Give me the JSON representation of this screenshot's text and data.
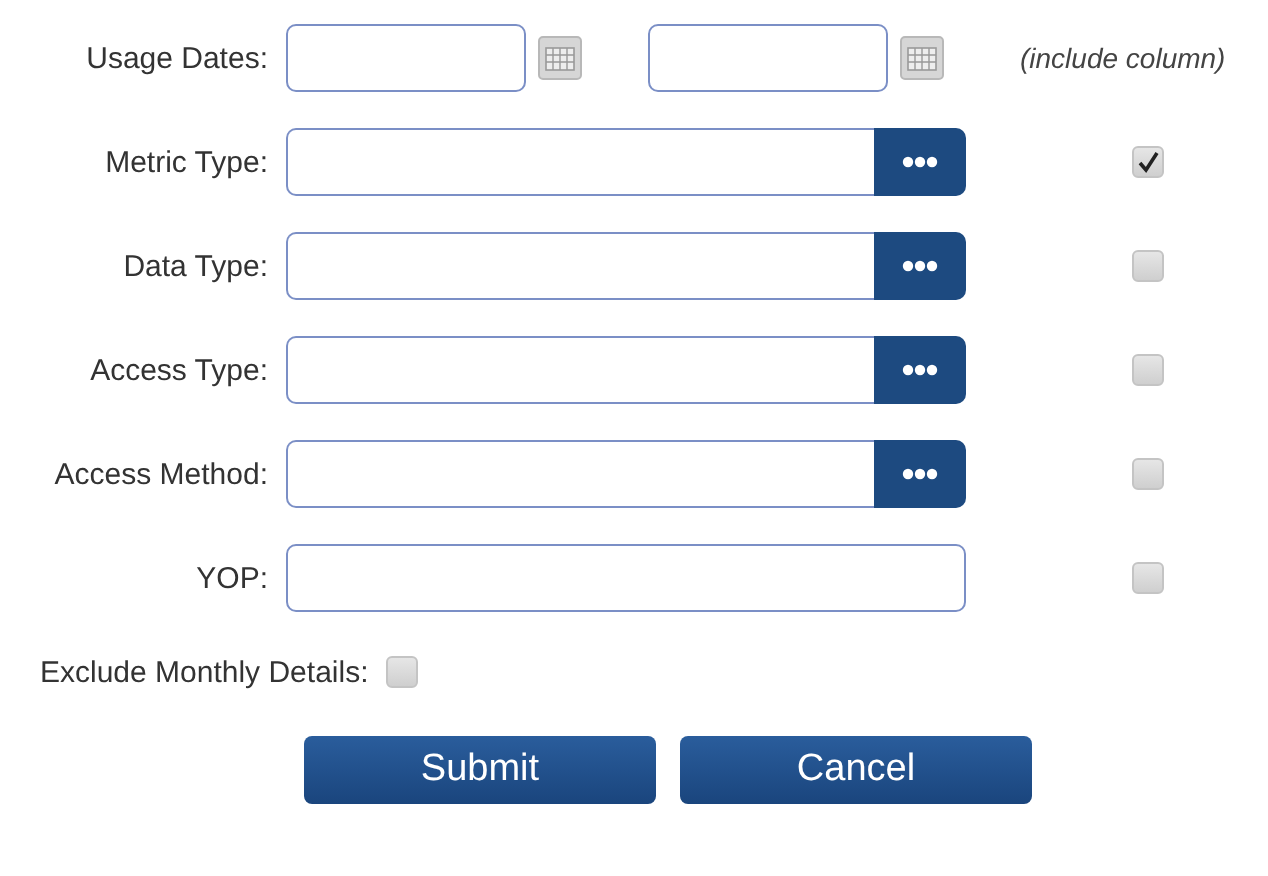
{
  "include_note": "(include column)",
  "rows": [
    {
      "kind": "dates",
      "label": "Usage Dates:"
    },
    {
      "kind": "picker",
      "label": "Metric Type:",
      "include": true
    },
    {
      "kind": "picker",
      "label": "Data Type:",
      "include": false
    },
    {
      "kind": "picker",
      "label": "Access Type:",
      "include": false
    },
    {
      "kind": "picker",
      "label": "Access Method:",
      "include": false
    },
    {
      "kind": "text",
      "label": "YOP:",
      "include": false
    }
  ],
  "exclude": {
    "label": "Exclude Monthly Details:",
    "checked": false
  },
  "buttons": [
    {
      "label": "Submit"
    },
    {
      "label": "Cancel"
    }
  ]
}
